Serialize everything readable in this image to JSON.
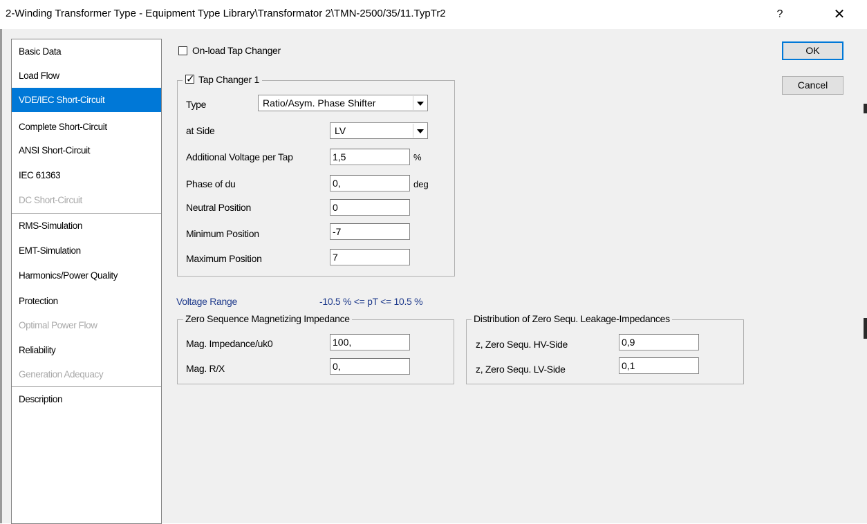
{
  "window": {
    "title": "2-Winding Transformer Type - Equipment Type Library\\Transformator 2\\TMN-2500/35/11.TypTr2",
    "help_glyph": "?",
    "close_glyph": "✕"
  },
  "sidebar": {
    "items": [
      {
        "label": "Basic Data",
        "state": "normal"
      },
      {
        "label": "Load Flow",
        "state": "normal"
      },
      {
        "label": "VDE/IEC Short-Circuit",
        "state": "selected"
      },
      {
        "label": "Complete Short-Circuit",
        "state": "normal"
      },
      {
        "label": "ANSI Short-Circuit",
        "state": "normal"
      },
      {
        "label": "IEC 61363",
        "state": "normal"
      },
      {
        "label": "DC Short-Circuit",
        "state": "disabled"
      },
      {
        "label": "RMS-Simulation",
        "state": "normal"
      },
      {
        "label": "EMT-Simulation",
        "state": "normal"
      },
      {
        "label": "Harmonics/Power Quality",
        "state": "normal"
      },
      {
        "label": "Protection",
        "state": "normal"
      },
      {
        "label": "Optimal Power Flow",
        "state": "disabled"
      },
      {
        "label": "Reliability",
        "state": "normal"
      },
      {
        "label": "Generation Adequacy",
        "state": "disabled"
      },
      {
        "label": "Description",
        "state": "normal"
      }
    ]
  },
  "onload_tap_changer": {
    "label": "On-load Tap Changer",
    "checked": false
  },
  "tap_changer": {
    "label": "Tap Changer 1",
    "checked": true,
    "type": {
      "label": "Type",
      "value": "Ratio/Asym. Phase Shifter"
    },
    "side": {
      "label": "at Side",
      "value": "LV"
    },
    "additional_voltage": {
      "label": "Additional Voltage per Tap",
      "value": "1,5",
      "unit": "%"
    },
    "phase": {
      "label": "Phase of du",
      "value": "0,",
      "unit": "deg"
    },
    "neutral": {
      "label": "Neutral Position",
      "value": "0"
    },
    "minimum": {
      "label": "Minimum Position",
      "value": "-7"
    },
    "maximum": {
      "label": "Maximum Position",
      "value": "7"
    }
  },
  "voltage_range": {
    "label": "Voltage Range",
    "value": "-10.5 % <= pT <= 10.5 %"
  },
  "zero_seq_mag": {
    "title": "Zero Sequence Magnetizing Impedance",
    "mag_impedance": {
      "label": "Mag. Impedance/uk0",
      "value": "100,"
    },
    "mag_rx": {
      "label": "Mag. R/X",
      "value": "0,"
    }
  },
  "zero_seq_dist": {
    "title": "Distribution of Zero Sequ. Leakage-Impedances",
    "hv": {
      "label": "z, Zero Sequ. HV-Side",
      "value": "0,9"
    },
    "lv": {
      "label": "z, Zero Sequ. LV-Side",
      "value": "0,1"
    }
  },
  "buttons": {
    "ok": "OK",
    "cancel": "Cancel"
  },
  "colors": {
    "selected": "#0078d7",
    "info_text": "#1f3b8c",
    "disabled_text": "#a8a8a8"
  }
}
